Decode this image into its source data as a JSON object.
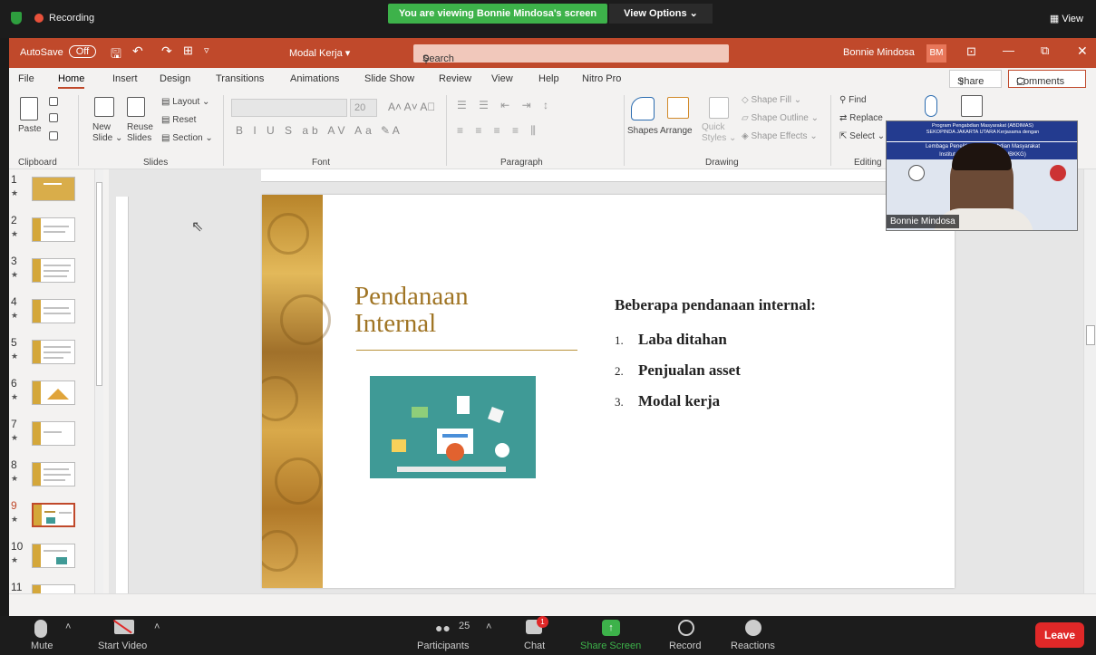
{
  "zoom_top": {
    "recording": "Recording",
    "viewing_banner": "You are viewing Bonnie Mindosa's screen",
    "view_options": "View Options ⌄",
    "view": "View"
  },
  "titlebar": {
    "autosave": "AutoSave",
    "autosave_state": "Off",
    "filename": "Modal Kerja ▾",
    "search_placeholder": "Search",
    "user": "Bonnie Mindosa",
    "initials": "BM"
  },
  "tabs": [
    "File",
    "Home",
    "Insert",
    "Design",
    "Transitions",
    "Animations",
    "Slide Show",
    "Review",
    "View",
    "Help",
    "Nitro Pro"
  ],
  "share": "Share",
  "comments": "Comments",
  "ribbon": {
    "paste": "Paste",
    "new_slide": "New\nSlide ⌄",
    "reuse_slides": "Reuse\nSlides",
    "layout": "Layout ⌄",
    "reset": "Reset",
    "section": "Section ⌄",
    "font_size": "20",
    "shapes": "Shapes",
    "arrange": "Arrange",
    "quick_styles": "Quick\nStyles ⌄",
    "shape_fill": "Shape Fill ⌄",
    "shape_outline": "Shape Outline ⌄",
    "shape_effects": "Shape Effects ⌄",
    "find": "Find",
    "replace": "Replace",
    "select": "Select ⌄",
    "groups": [
      "Clipboard",
      "Slides",
      "Font",
      "Paragraph",
      "Drawing",
      "Editing"
    ]
  },
  "slides": [
    {
      "num": "1",
      "star": "★"
    },
    {
      "num": "2",
      "star": "★"
    },
    {
      "num": "3",
      "star": "★"
    },
    {
      "num": "4",
      "star": "★"
    },
    {
      "num": "5",
      "star": "★"
    },
    {
      "num": "6",
      "star": "★"
    },
    {
      "num": "7",
      "star": "★"
    },
    {
      "num": "8",
      "star": "★"
    },
    {
      "num": "9",
      "star": "★"
    },
    {
      "num": "10",
      "star": "★"
    },
    {
      "num": "11",
      "star": ""
    }
  ],
  "selected_slide": 9,
  "slide": {
    "title_line1": "Pendanaan",
    "title_line2": "Internal",
    "heading": "Beberapa pendanaan internal:",
    "items": [
      {
        "num": "1.",
        "text": "Laba ditahan"
      },
      {
        "num": "2.",
        "text": "Penjualan asset"
      },
      {
        "num": "3.",
        "text": "Modal kerja"
      }
    ]
  },
  "video": {
    "banner1": "Program Pengabdian Masyarakat (ABDIMAS)\nSEKOPINDA JAKARTA UTARA Kerjasama dengan",
    "banner2": "Lembaga Penelitian ... Pengabdian Masyarakat\nInstitut Bisnis dan ... (LPPM IBKKG)",
    "name": "Bonnie Mindosa"
  },
  "zoom_bottom": {
    "mute": "Mute",
    "start_video": "Start Video",
    "participants": "Participants",
    "participants_count": "25",
    "chat": "Chat",
    "chat_badge": "1",
    "share_screen": "Share Screen",
    "record": "Record",
    "reactions": "Reactions",
    "leave": "Leave"
  },
  "colors": {
    "ppt_accent": "#c0492b",
    "zoom_green": "#3db24a",
    "leave_red": "#e02828",
    "slide_gold": "#a07525"
  }
}
